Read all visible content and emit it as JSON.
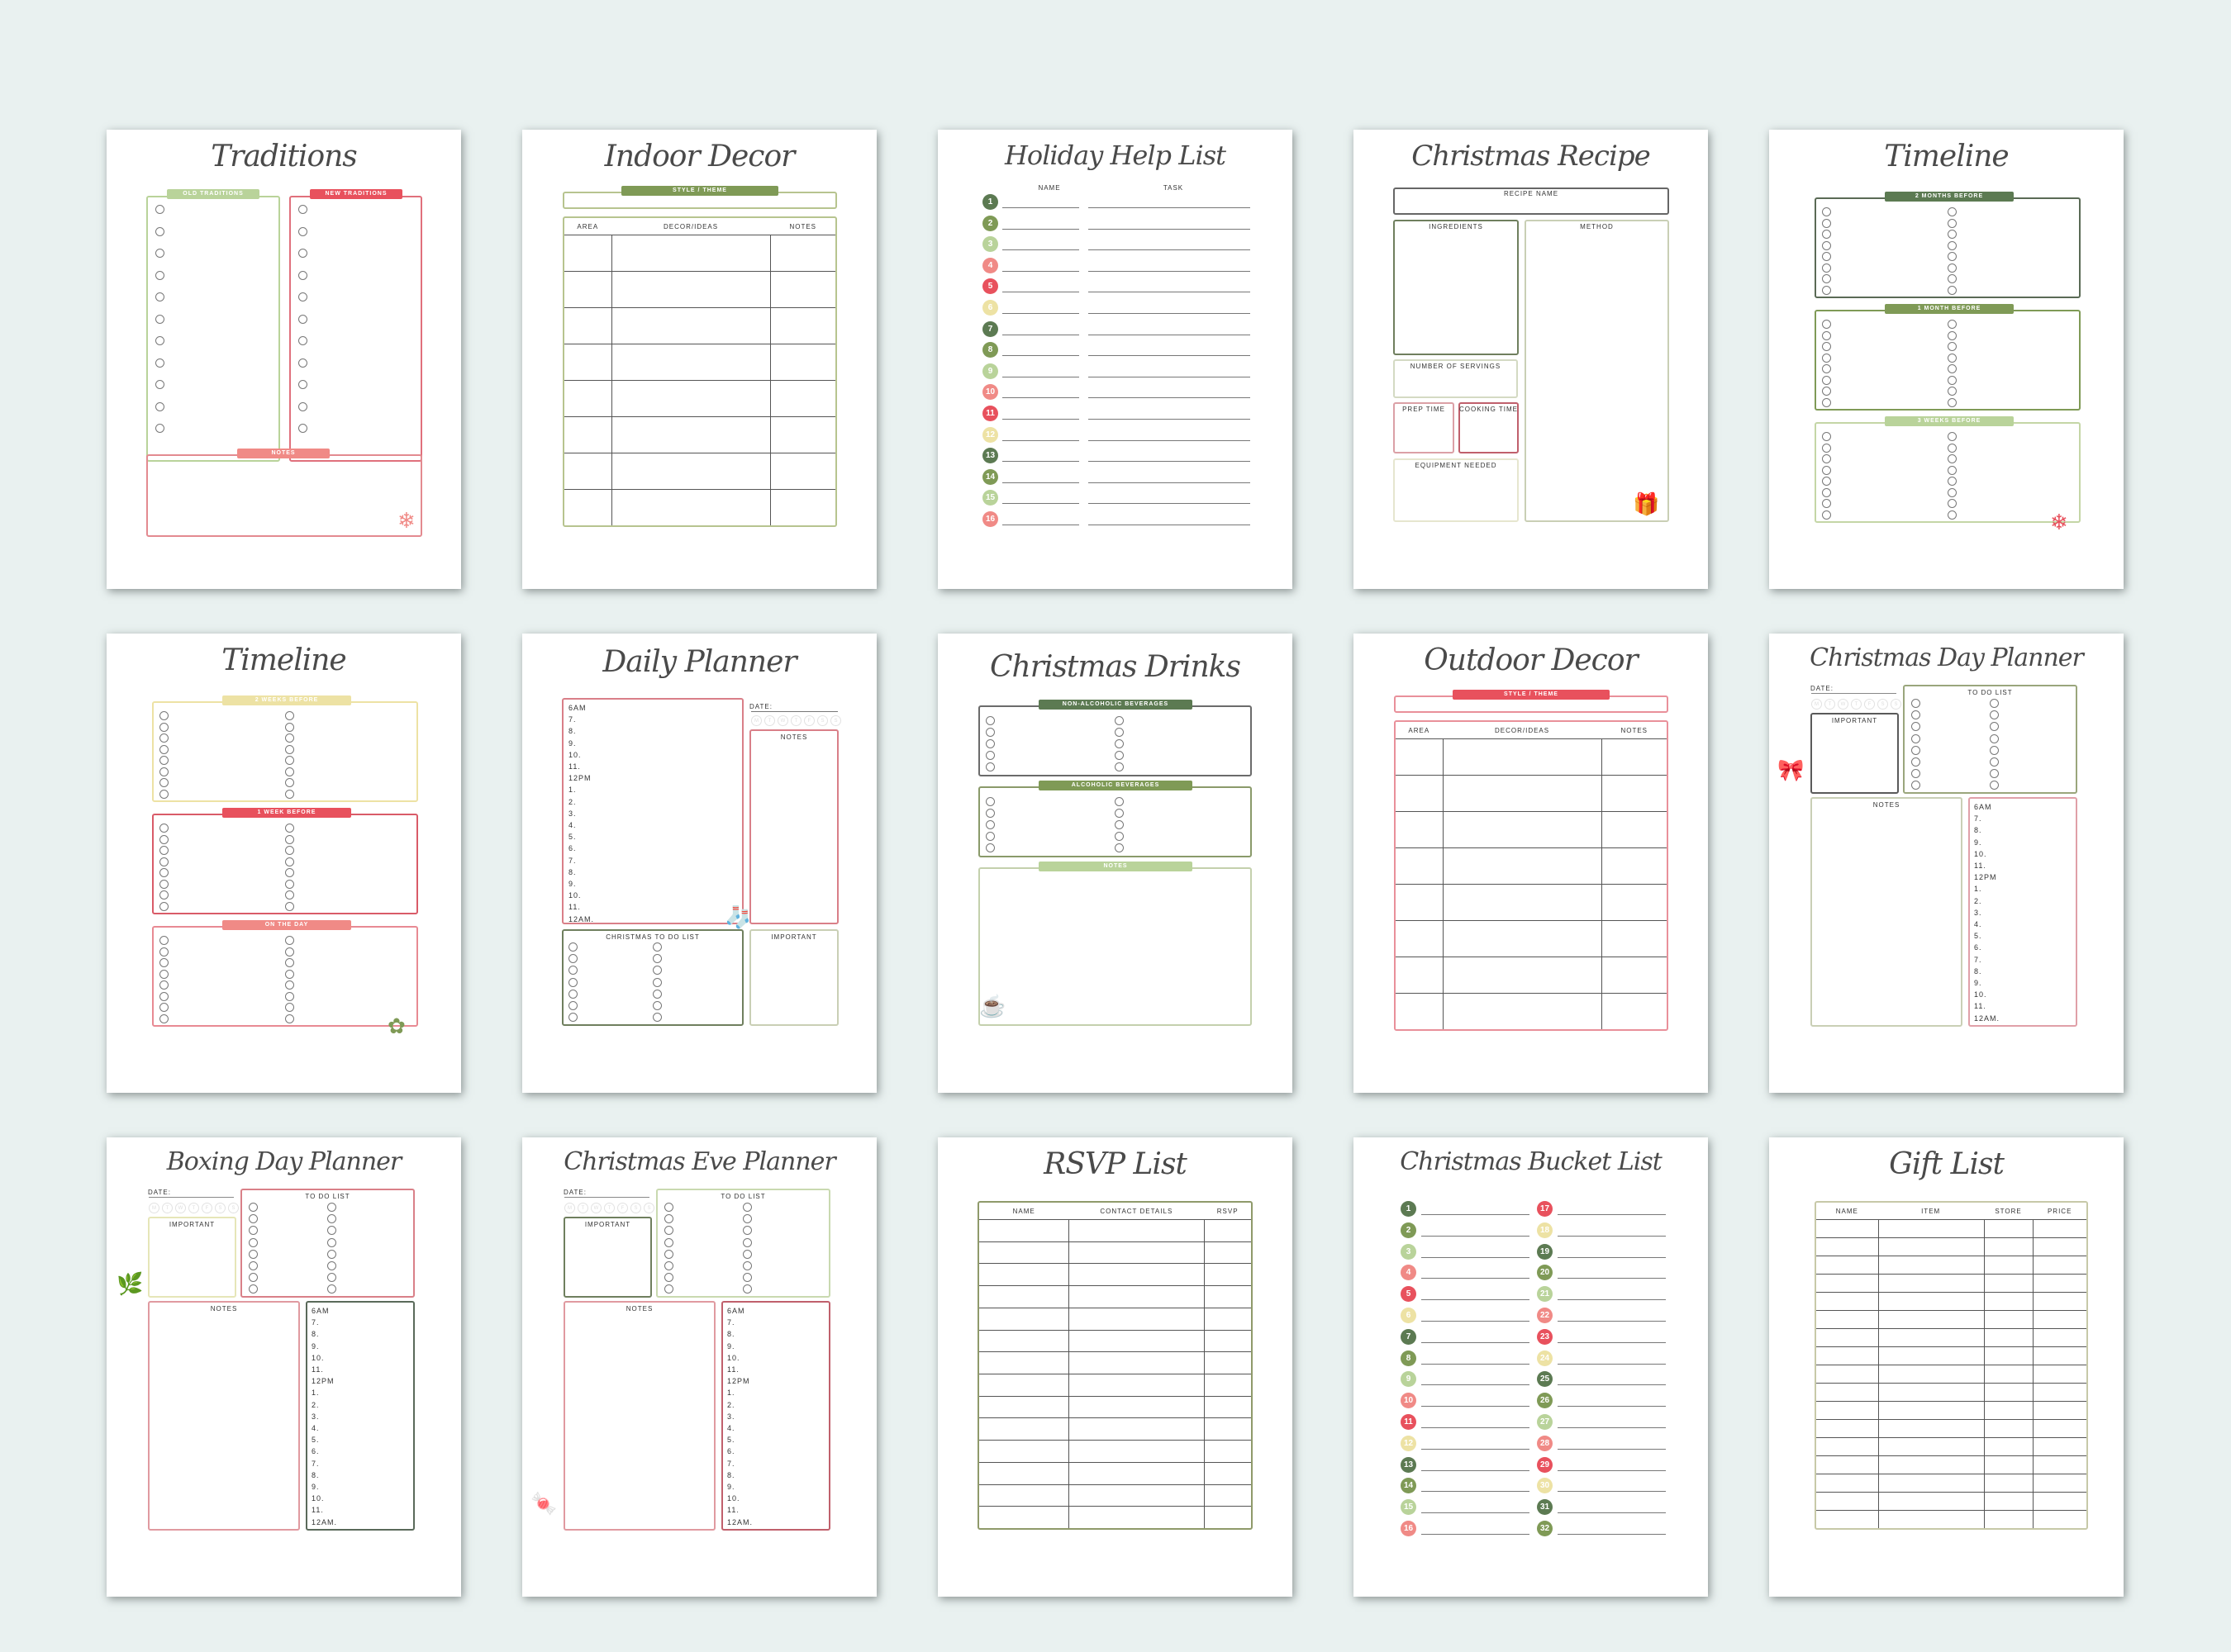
{
  "colors": {
    "background": "#e9f1f0",
    "dark_green": "#5c7a52",
    "olive": "#7f9a56",
    "light_green": "#b9d39a",
    "pink": "#f08a86",
    "red": "#e8515d",
    "cream": "#ede2a4",
    "ink": "#4a4a4a"
  },
  "pages": [
    {
      "title": "Traditions",
      "sections": [
        {
          "label": "OLD TRADITIONS"
        },
        {
          "label": "NEW TRADITIONS"
        },
        {
          "label": "NOTES"
        }
      ],
      "decoration": "snowflake-icon"
    },
    {
      "title": "Indoor Decor",
      "style_label": "STYLE / THEME",
      "columns": [
        "AREA",
        "DECOR/IDEAS",
        "NOTES"
      ]
    },
    {
      "title": "Holiday Help List",
      "columns": [
        "NAME",
        "TASK"
      ],
      "numbers": [
        "1",
        "2",
        "3",
        "4",
        "5",
        "6",
        "7",
        "8",
        "9",
        "10",
        "11",
        "12",
        "13",
        "14",
        "15",
        "16"
      ]
    },
    {
      "title": "Christmas Recipe",
      "fields": [
        "RECIPE NAME",
        "INGREDIENTS",
        "METHOD",
        "NUMBER OF SERVINGS",
        "PREP TIME",
        "COOKING TIME",
        "EQUIPMENT NEEDED"
      ],
      "decoration": "gift-icon"
    },
    {
      "title": "Timeline",
      "sections": [
        {
          "label": "2 MONTHS BEFORE"
        },
        {
          "label": "1 MONTH BEFORE"
        },
        {
          "label": "3 WEEKS BEFORE"
        }
      ],
      "decoration": "snowflake-icon"
    },
    {
      "title": "Timeline",
      "sections": [
        {
          "label": "2 WEEKS BEFORE"
        },
        {
          "label": "1 WEEK BEFORE"
        },
        {
          "label": "ON THE DAY"
        }
      ],
      "decoration": "wreath-icon"
    },
    {
      "title": "Daily Planner",
      "date_label": "DATE:",
      "notes_label": "NOTES",
      "todo_label": "CHRISTMAS TO DO LIST",
      "important_label": "IMPORTANT",
      "decoration": "stocking-icon"
    },
    {
      "title": "Christmas Drinks",
      "sections": [
        {
          "label": "NON-ALCOHOLIC BEVERAGES"
        },
        {
          "label": "ALCOHOLIC BEVERAGES"
        },
        {
          "label": "NOTES"
        }
      ],
      "decoration": "mug-icon"
    },
    {
      "title": "Outdoor Decor",
      "style_label": "STYLE / THEME",
      "columns": [
        "AREA",
        "DECOR/IDEAS",
        "NOTES"
      ]
    },
    {
      "title": "Christmas Day Planner",
      "date_label": "DATE:",
      "todo_label": "TO DO LIST",
      "important_label": "IMPORTANT",
      "notes_label": "NOTES",
      "decoration": "bow-icon"
    },
    {
      "title": "Boxing Day Planner",
      "date_label": "DATE:",
      "todo_label": "TO DO LIST",
      "important_label": "IMPORTANT",
      "notes_label": "NOTES",
      "decoration": "mistletoe-icon"
    },
    {
      "title": "Christmas Eve Planner",
      "date_label": "DATE:",
      "todo_label": "TO DO LIST",
      "important_label": "IMPORTANT",
      "notes_label": "NOTES",
      "decoration": "candy-cane-icon"
    },
    {
      "title": "RSVP List",
      "columns": [
        "NAME",
        "CONTACT DETAILS",
        "RSVP"
      ]
    },
    {
      "title": "Christmas Bucket List",
      "numbers": [
        "1",
        "2",
        "3",
        "4",
        "5",
        "6",
        "7",
        "8",
        "9",
        "10",
        "11",
        "12",
        "13",
        "14",
        "15",
        "16",
        "17",
        "18",
        "19",
        "20",
        "21",
        "22",
        "23",
        "24",
        "25",
        "26",
        "27",
        "28",
        "29",
        "30",
        "31",
        "32"
      ]
    },
    {
      "title": "Gift List",
      "columns": [
        "NAME",
        "ITEM",
        "STORE",
        "PRICE"
      ]
    }
  ],
  "hours": [
    "6AM",
    "7.",
    "8.",
    "9.",
    "10.",
    "11.",
    "12PM",
    "1.",
    "2.",
    "3.",
    "4.",
    "5.",
    "6.",
    "7.",
    "8.",
    "9.",
    "10.",
    "11.",
    "12AM."
  ],
  "weekdays": [
    "M",
    "T",
    "W",
    "T",
    "F",
    "S",
    "S"
  ]
}
